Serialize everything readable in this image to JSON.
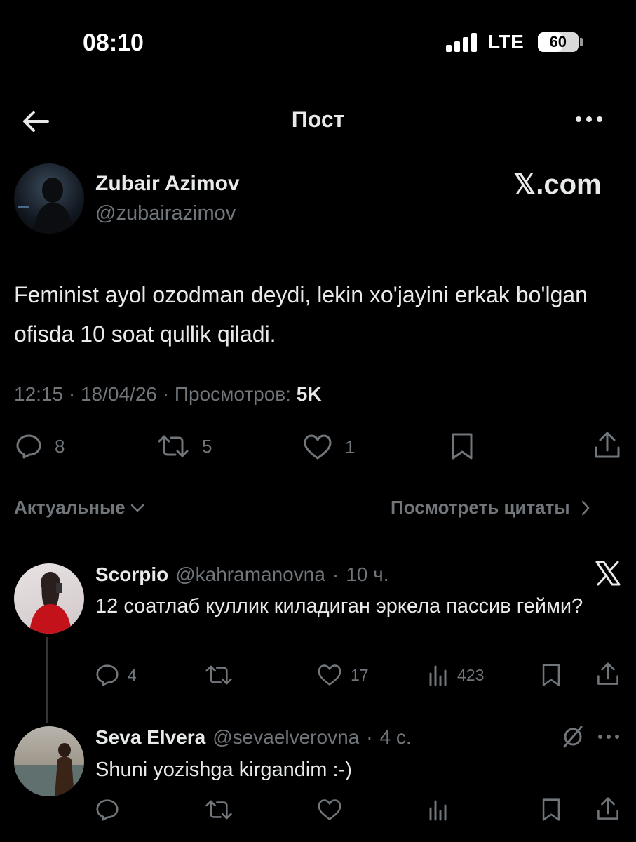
{
  "status_bar": {
    "time": "08:10",
    "network": "LTE",
    "battery": "60",
    "battery_level": 0.6
  },
  "nav": {
    "title": "Пост"
  },
  "post": {
    "author_name": "Zubair Azimov",
    "author_handle": "@zubairazimov",
    "brand": "𝕏.com",
    "text": "Feminist ayol ozodman deydi, lekin xo'jayini erkak bo'lgan ofisda 10 soat qullik qiladi.",
    "time": "12:15",
    "date": "18/04/26",
    "views_label": "Просмотров:",
    "views": "5K",
    "stats": {
      "replies": "8",
      "reposts": "5",
      "likes": "1"
    }
  },
  "tabs": {
    "sort_label": "Актуальные",
    "quotes_label": "Посмотреть цитаты"
  },
  "replies": [
    {
      "name": "Scorpio",
      "handle": "@kahramanovna",
      "time": "10 ч.",
      "text": "12 соатлаб куллик киладиган эркела пассив гейми?",
      "replies": "4",
      "reposts": "",
      "likes": "17",
      "views": "423"
    },
    {
      "name": "Seva Elvera",
      "handle": "@sevaelverovna",
      "time": "4 с.",
      "text": "Shuni yozishga kirgandim :-)",
      "replies": "",
      "reposts": "",
      "likes": "",
      "views": ""
    }
  ],
  "colors": {
    "background": "#000000",
    "text": "#e7e9ea",
    "muted": "#71767b",
    "divider": "#2f3336"
  },
  "icons": [
    "back-arrow-icon",
    "more-icon",
    "reply-icon",
    "repost-icon",
    "like-icon",
    "bookmark-icon",
    "share-icon",
    "views-icon",
    "x-logo-icon",
    "grok-icon",
    "chevron-down-icon",
    "chevron-right-icon"
  ]
}
